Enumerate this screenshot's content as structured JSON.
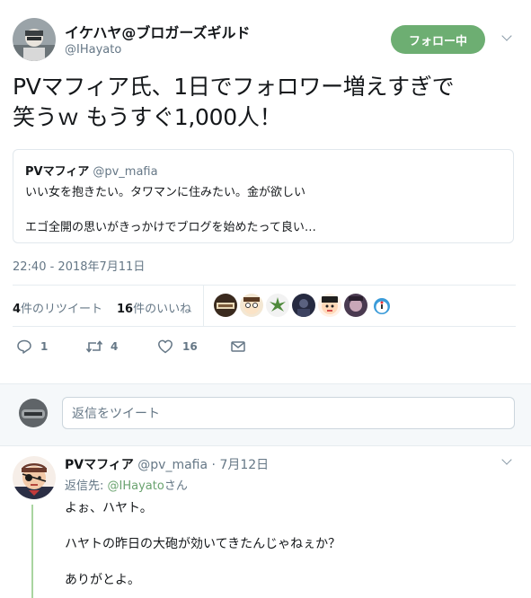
{
  "tweet": {
    "author_name": "イケハヤ@ブロガーズギルド",
    "author_handle": "@IHayato",
    "follow_label": "フォロー中",
    "text_line1": "PVマフィア氏、1日でフォロワー増えすぎで",
    "text_line2": "笑うｗ もうすぐ1,000人！",
    "timestamp": "22:40 - 2018年7月11日",
    "retweet_count": "4",
    "retweet_label": "件のリツイート",
    "like_count": "16",
    "like_label": "件のいいね",
    "likers_count": 7
  },
  "quoted": {
    "name": "PVマフィア",
    "handle": "@pv_mafia",
    "line1": "いい女を抱きたい。タワマンに住みたい。金が欲しい",
    "line2": "エゴ全開の思いがきっかけでブログを始めたって良い…"
  },
  "actions": {
    "reply_count": "1",
    "retweet_count": "4",
    "like_count": "16"
  },
  "reply_box": {
    "placeholder": "返信をツイート"
  },
  "reply": {
    "name": "PVマフィア",
    "handle": "@pv_mafia",
    "sep": " · ",
    "date": "7月12日",
    "to_label": "返信先: ",
    "to_handle": "@IHayato",
    "to_suffix": "さん",
    "line1": "よぉ、ハヤト。",
    "line2": "ハヤトの昨日の大砲が効いてきたんじゃねぇか？",
    "line3": "ありがとよ。"
  },
  "colors": {
    "follow_bg": "#6dae72",
    "thread_line": "#a9d5a0",
    "link": "#6aa36f"
  }
}
